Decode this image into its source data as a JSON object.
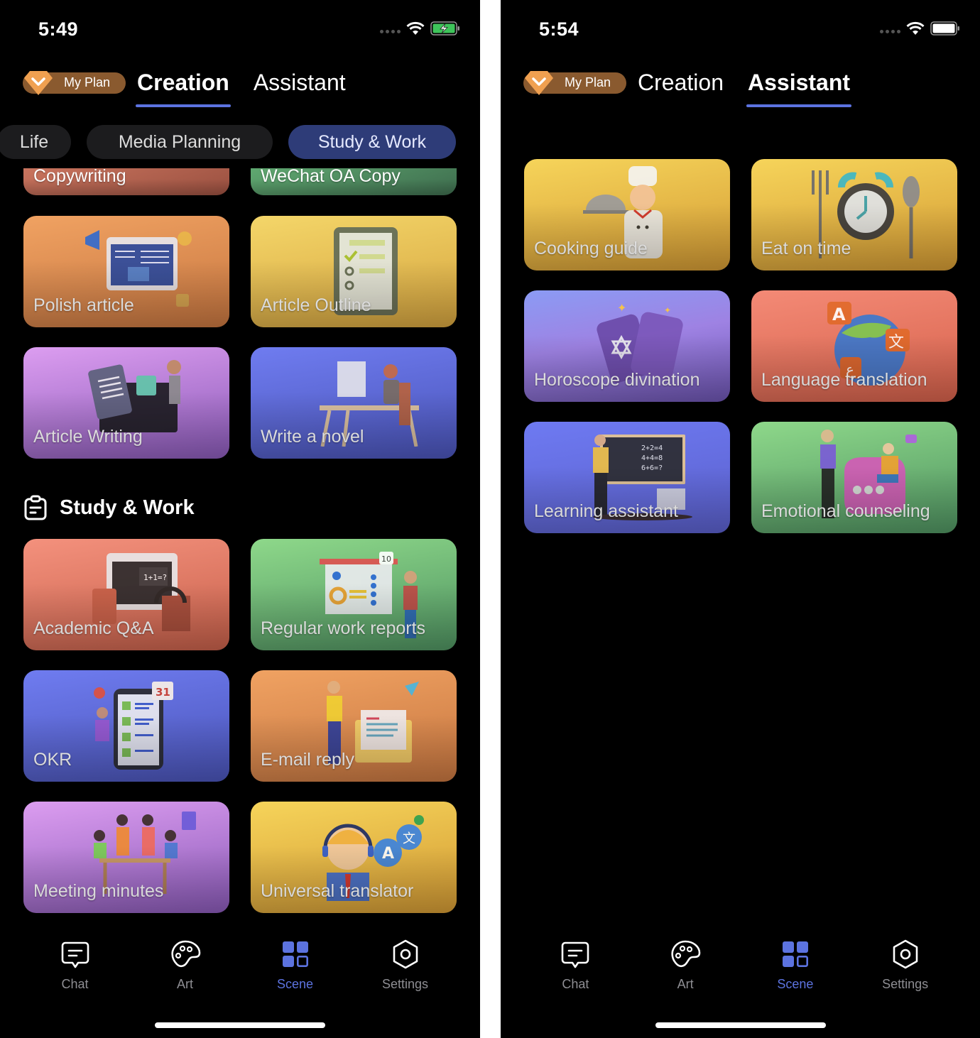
{
  "left": {
    "status": {
      "time": "5:49",
      "battery_state": "charging"
    },
    "header": {
      "plan_label": "My Plan",
      "tabs": [
        {
          "label": "Creation",
          "active": true
        },
        {
          "label": "Assistant",
          "active": false
        }
      ]
    },
    "chips": [
      {
        "label": "Life",
        "active": false
      },
      {
        "label": "Media Planning",
        "active": false
      },
      {
        "label": "Study & Work",
        "active": true
      }
    ],
    "partial_cards": [
      {
        "label": "Copywriting"
      },
      {
        "label": "WeChat OA Copy"
      }
    ],
    "media_cards": [
      {
        "label": "Polish article",
        "icon": "article-edit-illustration"
      },
      {
        "label": "Article Outline",
        "icon": "checklist-illustration"
      },
      {
        "label": "Article Writing",
        "icon": "document-writing-illustration"
      },
      {
        "label": "Write a novel",
        "icon": "desk-writer-illustration"
      }
    ],
    "section": {
      "title": "Study & Work",
      "icon": "clipboard-icon"
    },
    "study_cards": [
      {
        "label": "Academic Q&A",
        "icon": "academic-illustration"
      },
      {
        "label": "Regular work reports",
        "icon": "report-illustration"
      },
      {
        "label": "OKR",
        "icon": "phone-checklist-illustration"
      },
      {
        "label": "E-mail reply",
        "icon": "email-illustration"
      },
      {
        "label": "Meeting minutes",
        "icon": "meeting-illustration"
      },
      {
        "label": "Universal translator",
        "icon": "translator-illustration"
      }
    ],
    "tabbar": [
      {
        "label": "Chat",
        "icon": "chat-icon",
        "active": false
      },
      {
        "label": "Art",
        "icon": "palette-icon",
        "active": false
      },
      {
        "label": "Scene",
        "icon": "grid-icon",
        "active": true
      },
      {
        "label": "Settings",
        "icon": "settings-icon",
        "active": false
      }
    ]
  },
  "right": {
    "status": {
      "time": "5:54",
      "battery_state": "full"
    },
    "header": {
      "plan_label": "My Plan",
      "tabs": [
        {
          "label": "Creation",
          "active": false
        },
        {
          "label": "Assistant",
          "active": true
        }
      ]
    },
    "cards": [
      {
        "label": "Cooking guide",
        "icon": "chef-illustration"
      },
      {
        "label": "Eat on time",
        "icon": "alarm-clock-illustration"
      },
      {
        "label": "Horoscope divination",
        "icon": "tarot-cards-illustration"
      },
      {
        "label": "Language translation",
        "icon": "globe-languages-illustration"
      },
      {
        "label": "Learning assistant",
        "icon": "teacher-blackboard-illustration"
      },
      {
        "label": "Emotional counseling",
        "icon": "counseling-illustration"
      }
    ],
    "tabbar": [
      {
        "label": "Chat",
        "icon": "chat-icon",
        "active": false
      },
      {
        "label": "Art",
        "icon": "palette-icon",
        "active": false
      },
      {
        "label": "Scene",
        "icon": "grid-icon",
        "active": true
      },
      {
        "label": "Settings",
        "icon": "settings-icon",
        "active": false
      }
    ]
  },
  "colors": {
    "accent": "#5c73e0",
    "plan_pill": "#8a5a2f",
    "plan_gem": "#f0a050",
    "chip_active": "#2e3c78",
    "chip_inactive": "#1c1c1e",
    "background": "#000000"
  }
}
